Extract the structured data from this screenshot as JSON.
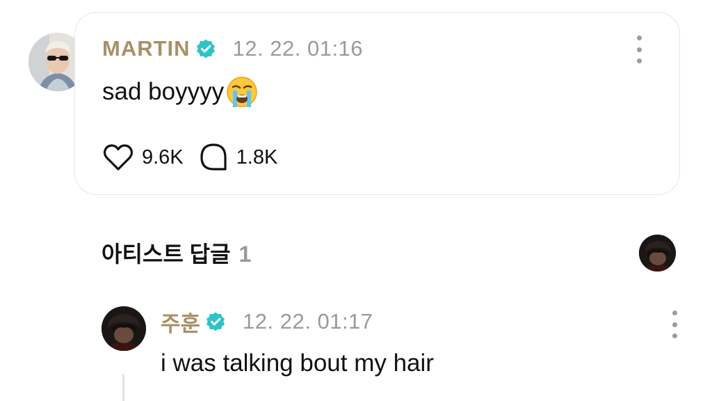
{
  "post": {
    "author": "MARTIN",
    "timestamp": "12. 22. 01:16",
    "text": "sad boyyyy",
    "emoji_icon": "loudly-crying-face-emoji",
    "likes": "9.6K",
    "comments": "1.8K"
  },
  "artist_replies": {
    "title": "아티스트 답글",
    "count": "1"
  },
  "reply": {
    "author": "주훈",
    "timestamp": "12. 22. 01:17",
    "text": "i was talking bout my hair"
  },
  "colors": {
    "author_gold": "#a89168",
    "verified_teal": "#2ec4c6",
    "muted_gray": "#9a9a9a",
    "card_border": "#e6e6e6"
  }
}
